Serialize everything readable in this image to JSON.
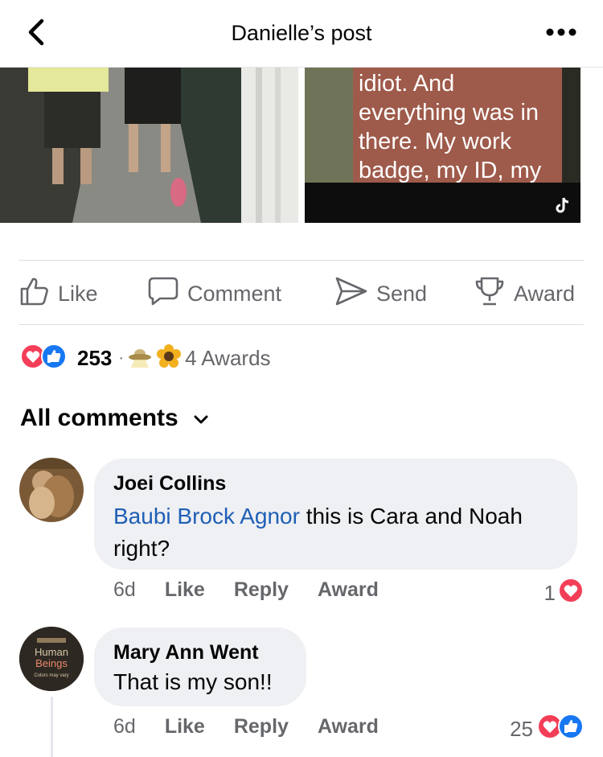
{
  "header": {
    "title": "Danielle’s post"
  },
  "media": {
    "caption_lines": [
      "idiot. And",
      "everything was in",
      "there. My work",
      "badge, my ID, my"
    ]
  },
  "actions": {
    "like": "Like",
    "comment": "Comment",
    "send": "Send",
    "award": "Award"
  },
  "reactions": {
    "count": "253",
    "separator": "·",
    "awards": "4 Awards"
  },
  "comments_header": {
    "label": "All comments"
  },
  "comments": [
    {
      "author": "Joei Collins",
      "mention": "Baubi Brock Agnor",
      "text": " this is Cara and Noah right?",
      "time": "6d",
      "like": "Like",
      "reply": "Reply",
      "award": "Award",
      "reaction_count": "1"
    },
    {
      "author": "Mary Ann Went",
      "text": "That is my son!!",
      "time": "6d",
      "like": "Like",
      "reply": "Reply",
      "award": "Award",
      "reaction_count": "25",
      "avatar_text": [
        "Human",
        "Beings",
        "Colors may vary"
      ]
    }
  ],
  "colors": {
    "accent_blue": "#1e5fb6",
    "like_blue": "#1877f2",
    "love_red": "#f33e58",
    "muted": "#65676b",
    "bubble": "#eff0f3"
  }
}
